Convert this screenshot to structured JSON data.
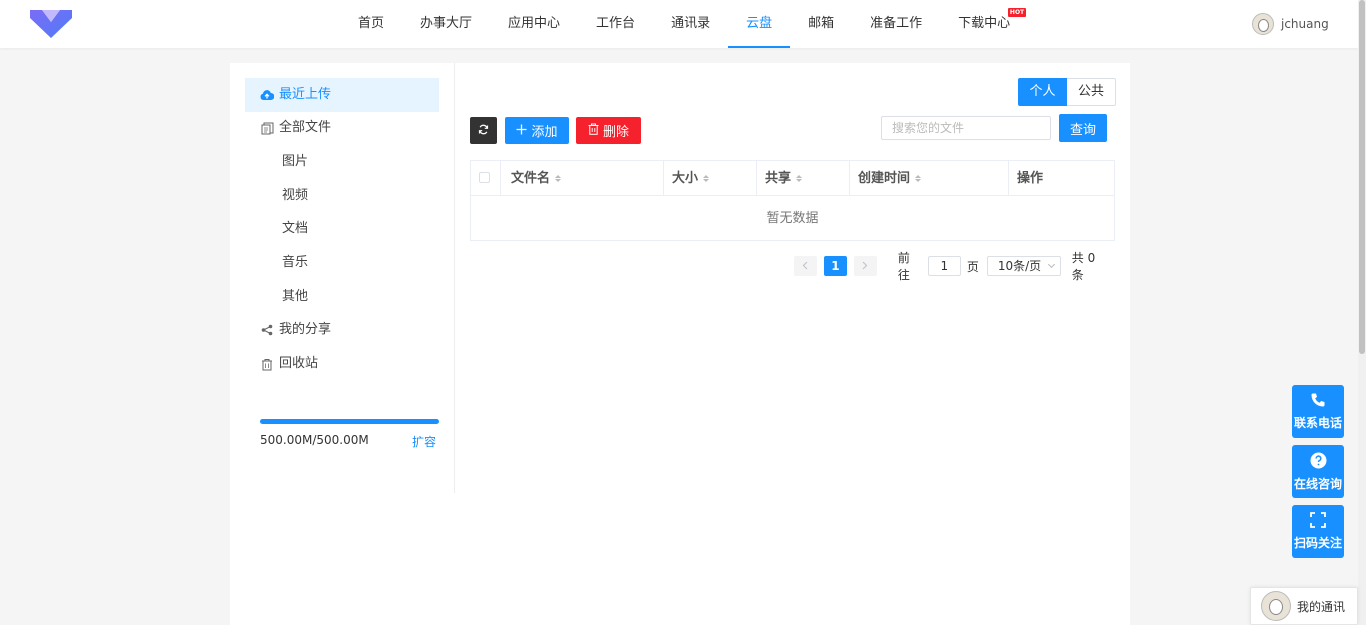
{
  "nav": {
    "items": [
      {
        "label": "首页"
      },
      {
        "label": "办事大厅"
      },
      {
        "label": "应用中心"
      },
      {
        "label": "工作台"
      },
      {
        "label": "通讯录"
      },
      {
        "label": "云盘",
        "active": true
      },
      {
        "label": "邮箱"
      },
      {
        "label": "准备工作"
      },
      {
        "label": "下载中心",
        "badge": "HOT"
      }
    ]
  },
  "user": {
    "name": "jchuang"
  },
  "sidebar": {
    "items": [
      {
        "label": "最近上传",
        "icon": "cloud-upload-icon",
        "active": true
      },
      {
        "label": "全部文件",
        "icon": "files-icon"
      },
      {
        "label": "图片"
      },
      {
        "label": "视频"
      },
      {
        "label": "文档"
      },
      {
        "label": "音乐"
      },
      {
        "label": "其他"
      },
      {
        "label": "我的分享",
        "icon": "share-icon"
      },
      {
        "label": "回收站",
        "icon": "trash-icon"
      }
    ],
    "storage": {
      "text": "500.00M/500.00M",
      "used_fraction": 1.0,
      "expand_label": "扩容"
    }
  },
  "toolbar": {
    "scope_tabs": [
      {
        "label": "个人",
        "active": true
      },
      {
        "label": "公共"
      }
    ],
    "add_label": "添加",
    "delete_label": "删除",
    "search_placeholder": "搜索您的文件",
    "query_label": "查询"
  },
  "table": {
    "columns": [
      "文件名",
      "大小",
      "共享",
      "创建时间",
      "操作"
    ],
    "empty_text": "暂无数据"
  },
  "pagination": {
    "current_page": "1",
    "goto_label": "前往",
    "goto_value": "1",
    "page_unit": "页",
    "page_size": "10条/页",
    "total_text": "共 0 条"
  },
  "floating": {
    "phone_label": "联系电话",
    "consult_label": "在线咨询",
    "scan_label": "扫码关注",
    "my_comm_label": "我的通讯"
  },
  "colors": {
    "primary": "#1890ff",
    "danger": "#f5222d",
    "dark": "#333333"
  }
}
